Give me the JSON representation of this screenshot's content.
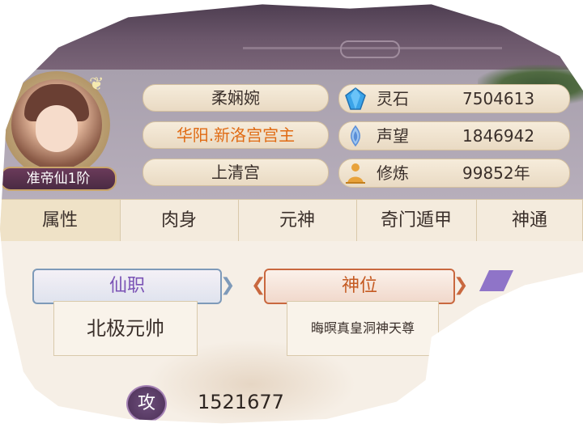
{
  "profile": {
    "name": "柔娴婉",
    "title": "华阳.新洛宫宫主",
    "sect": "上清宫",
    "rank_badge": "准帝仙1阶"
  },
  "resources": [
    {
      "label": "灵石",
      "value": "7504613",
      "icon": "crystal-icon",
      "color": "#3aa3e8"
    },
    {
      "label": "声望",
      "value": "1846942",
      "icon": "prestige-icon",
      "color": "#5b8fd8"
    },
    {
      "label": "修炼",
      "value": "99852年",
      "icon": "meditation-icon",
      "color": "#e8a23a"
    }
  ],
  "tabs": [
    {
      "label": "属性",
      "active": true
    },
    {
      "label": "肉身"
    },
    {
      "label": "元神"
    },
    {
      "label": "奇门遁甲"
    },
    {
      "label": "神通"
    }
  ],
  "cards": {
    "xianzhi": {
      "label": "仙职",
      "value": "北极元帅"
    },
    "shenwei": {
      "label": "神位",
      "value": "晦暝真皇洞神天尊"
    }
  },
  "stats": {
    "attack_icon_label": "攻",
    "attack_value": "1521677"
  },
  "colors": {
    "orange_title": "#e06b14",
    "xianzhi_text": "#7a52b5",
    "shenwei_text": "#c55a22"
  }
}
